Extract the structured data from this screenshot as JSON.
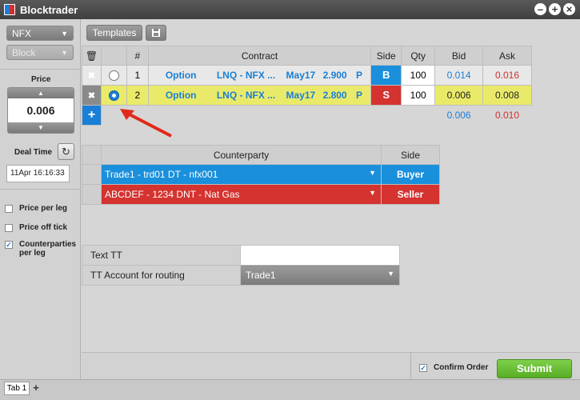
{
  "window": {
    "title": "Blocktrader"
  },
  "left": {
    "product_select": "NFX",
    "type_select": "Block",
    "price_label": "Price",
    "price_value": "0.006",
    "deal_time_label": "Deal Time",
    "deal_time_value": "11Apr 16:16:33",
    "options": [
      {
        "label": "Price per leg",
        "checked": false
      },
      {
        "label": "Price off tick",
        "checked": false
      },
      {
        "label": "Counterparties per leg",
        "checked": true
      }
    ]
  },
  "toolbar": {
    "templates_label": "Templates"
  },
  "legs": {
    "headers": [
      "#",
      "Contract",
      "Side",
      "Qty",
      "Bid",
      "Ask"
    ],
    "rows": [
      {
        "num": "1",
        "type": "Option",
        "contract": "LNQ - NFX ...",
        "expiry": "May17",
        "strike": "2.900",
        "pc": "P",
        "side": "B",
        "qty": "100",
        "bid": "0.014",
        "ask": "0.016",
        "selected": false
      },
      {
        "num": "2",
        "type": "Option",
        "contract": "LNQ - NFX ...",
        "expiry": "May17",
        "strike": "2.800",
        "pc": "P",
        "side": "S",
        "qty": "100",
        "bid": "0.006",
        "ask": "0.008",
        "selected": true
      }
    ],
    "totals": {
      "bid": "0.006",
      "ask": "0.010"
    }
  },
  "counterparty": {
    "headers": [
      "Counterparty",
      "Side"
    ],
    "rows": [
      {
        "name": "Trade1 - trd01 DT - nfx001",
        "side": "Buyer"
      },
      {
        "name": "ABCDEF - 1234 DNT - Nat Gas",
        "side": "Seller"
      }
    ]
  },
  "tt": {
    "text_label": "Text TT",
    "text_value": "",
    "account_label": "TT Account for routing",
    "account_value": "Trade1"
  },
  "bottom": {
    "confirm_label": "Confirm Order",
    "confirm_checked": true,
    "submit_label": "Submit"
  },
  "tabs": {
    "tab1": "Tab 1",
    "add": "+"
  },
  "colors": {
    "buy": "#1a8fdc",
    "sell": "#d4332f",
    "highlight": "#eaea6a",
    "submit": "#57ad25"
  }
}
